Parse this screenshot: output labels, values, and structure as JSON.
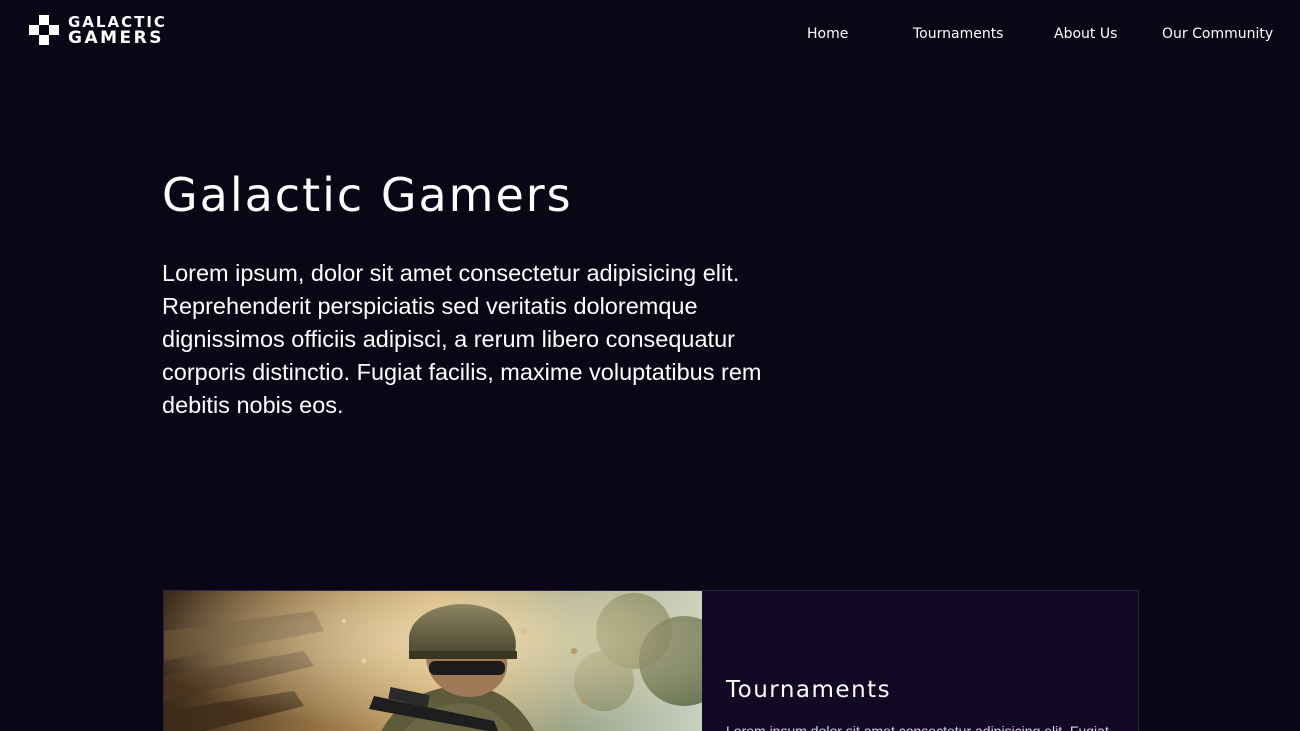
{
  "brand": {
    "line1": "GALACTIC",
    "line2": "GAMERS",
    "logo_icon": "controller-cross-icon"
  },
  "nav": {
    "items": [
      {
        "label": "Home"
      },
      {
        "label": "Tournaments"
      },
      {
        "label": "About Us"
      },
      {
        "label": "Our Community"
      }
    ]
  },
  "hero": {
    "title": "Galactic Gamers",
    "text": "Lorem ipsum, dolor sit amet consectetur adipisicing elit. Reprehenderit perspiciatis sed veritatis doloremque dignissimos officiis adipisci, a rerum libero consequatur corporis distinctio. Fugiat facilis, maxime voluptatibus rem debitis nobis eos."
  },
  "card": {
    "image": "soldier-with-rifle-image",
    "title": "Tournaments",
    "text": "Lorem ipsum dolor sit amet consectetur adipisicing elit. Fugiat"
  },
  "colors": {
    "background": "#0a0616",
    "card_background": "#120a25",
    "text": "#ffffff"
  }
}
